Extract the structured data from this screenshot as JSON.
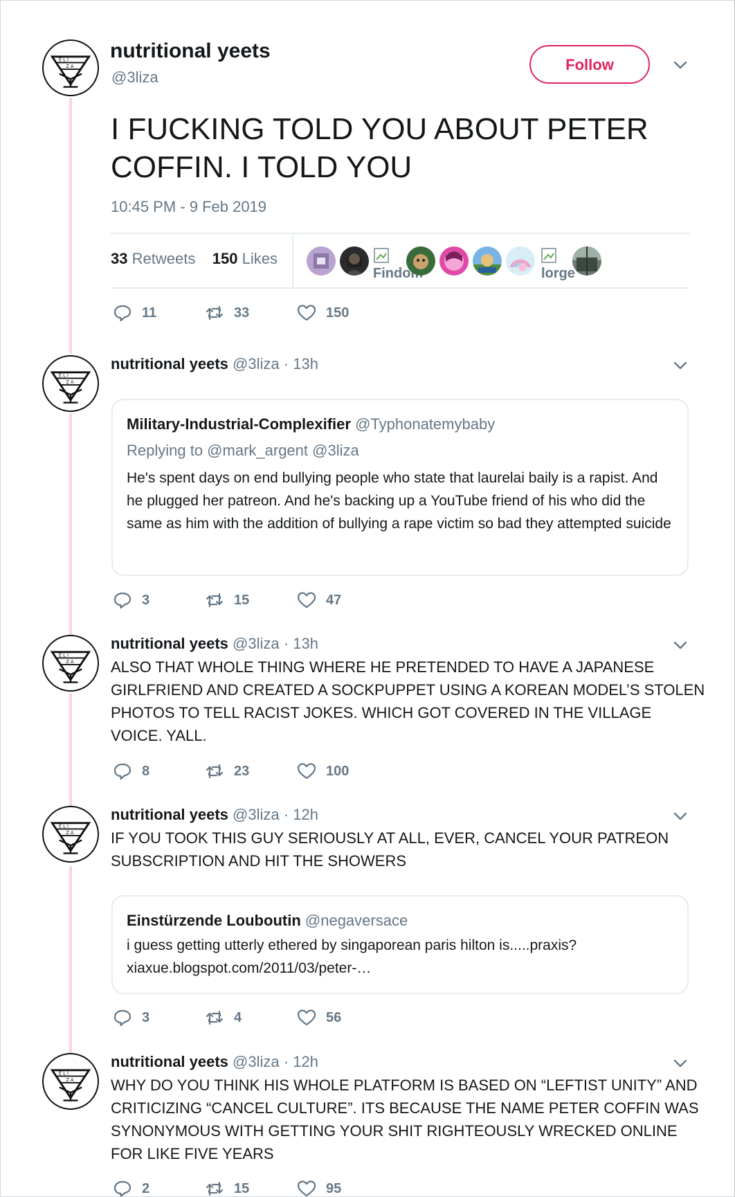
{
  "main": {
    "name": "nutritional yeets",
    "handle": "@3liza",
    "follow_label": "Follow",
    "text": "I FUCKING TOLD YOU ABOUT PETER COFFIN. I TOLD YOU",
    "timestamp": "10:45 PM - 9 Feb 2019",
    "retweets_count": "33",
    "retweets_label": "Retweets",
    "likes_count": "150",
    "likes_label": "Likes",
    "liker_broken_labels": [
      "Findom",
      "lorge"
    ],
    "actions": {
      "replies": "11",
      "retweets": "33",
      "likes": "150"
    }
  },
  "replies": [
    {
      "name": "nutritional yeets",
      "handle": "@3liza",
      "sep": "·",
      "time": "13h",
      "text": "",
      "quote": {
        "name": "Military-Industrial-Complexifier",
        "handle": "@Typhonatemybaby",
        "replying_to": "Replying to @mark_argent @3liza",
        "text": "He's spent days on end bullying  people who state that laurelai baily is a rapist. And he plugged her patreon. And he's backing up a YouTube friend of his who did the same as him with the addition of bullying a rape victim so bad they attempted suicide"
      },
      "actions": {
        "replies": "3",
        "retweets": "15",
        "likes": "47"
      }
    },
    {
      "name": "nutritional yeets",
      "handle": "@3liza",
      "sep": "·",
      "time": "13h",
      "text": "ALSO THAT WHOLE THING WHERE HE PRETENDED TO HAVE A JAPANESE GIRLFRIEND AND CREATED A SOCKPUPPET USING A KOREAN MODEL’S STOLEN PHOTOS TO TELL RACIST JOKES. WHICH GOT COVERED IN THE VILLAGE VOICE. YALL.",
      "actions": {
        "replies": "8",
        "retweets": "23",
        "likes": "100"
      }
    },
    {
      "name": "nutritional yeets",
      "handle": "@3liza",
      "sep": "·",
      "time": "12h",
      "text": "IF YOU TOOK THIS GUY SERIOUSLY AT ALL, EVER, CANCEL YOUR PATREON SUBSCRIPTION AND HIT THE SHOWERS",
      "quote": {
        "name": "Einstürzende Louboutin",
        "handle": "@negaversace",
        "text": "i guess getting utterly ethered by singaporean paris hilton is.....praxis? xiaxue.blogspot.com/2011/03/peter-…"
      },
      "actions": {
        "replies": "3",
        "retweets": "4",
        "likes": "56"
      }
    },
    {
      "name": "nutritional yeets",
      "handle": "@3liza",
      "sep": "·",
      "time": "12h",
      "text": "WHY DO YOU THINK HIS WHOLE PLATFORM IS BASED ON “LEFTIST UNITY” AND CRITICIZING “CANCEL CULTURE”. ITS BECAUSE THE NAME PETER COFFIN WAS SYNONYMOUS WITH GETTING YOUR SHIT RIGHTEOUSLY WRECKED ONLINE FOR LIKE FIVE YEARS",
      "actions": {
        "replies": "2",
        "retweets": "15",
        "likes": "95"
      }
    }
  ],
  "colors": {
    "accent": "#e0245e",
    "muted": "#657786",
    "thread_line": "#fbd2dd",
    "border": "#e6ecf0"
  },
  "icons": [
    "reply-icon",
    "retweet-icon",
    "like-icon",
    "chevron-down-icon",
    "triangle-logo-icon"
  ]
}
